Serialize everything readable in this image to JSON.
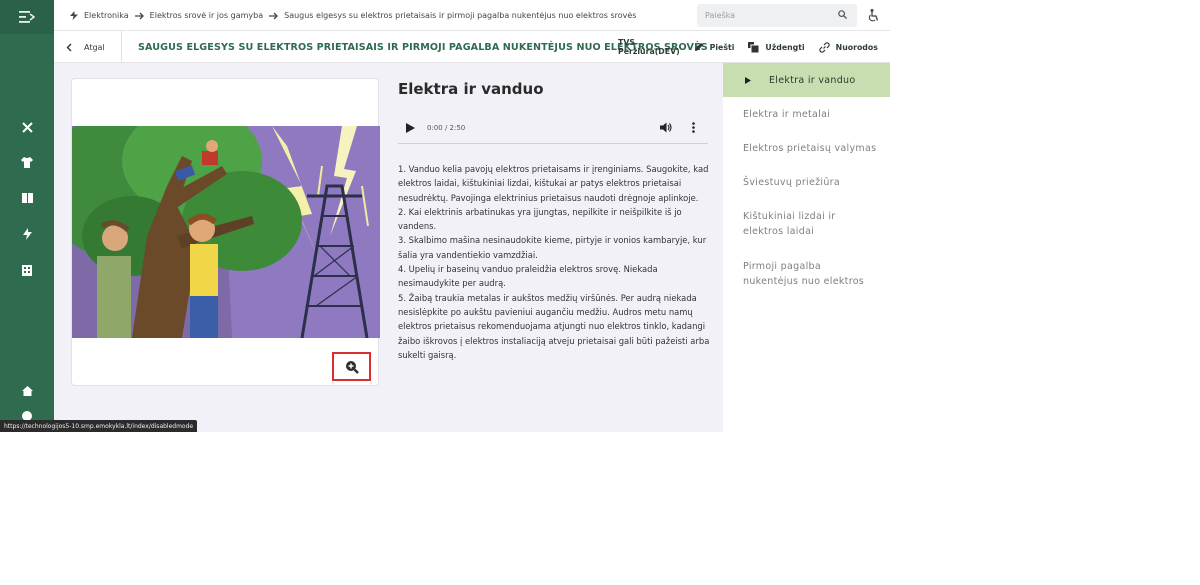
{
  "breadcrumbs": {
    "item1": "Elektronika",
    "item2": "Elektros srovė ir jos gamyba",
    "item3": "Saugus elgesys su elektros prietaisais ir pirmoji pagalba nukentėjus nuo elektros srovės"
  },
  "search": {
    "placeholder": "Paieška"
  },
  "header": {
    "back_label": "Atgal",
    "title": "SAUGUS ELGESYS SU ELEKTROS PRIETAISAIS IR PIRMOJI PAGALBA NUKENTĖJUS NUO ELEKTROS SROVĖS",
    "tvs": "TVS Peržiūra(DEV)",
    "draw": "Piešti",
    "cover": "Uždengti",
    "links": "Nuorodos"
  },
  "lesson": {
    "title": "Elektra ir vanduo",
    "audio_time": "0:00 / 2:50",
    "paragraphs": [
      "1. Vanduo kelia pavojų elektros prietaisams ir įrenginiams. Saugokite, kad elektros laidai, kištukiniai lizdai, kištukai ar patys elektros prietaisai nesudrėktų. Pavojinga elektrinius prietaisus naudoti drėgnoje aplinkoje.",
      "2. Kai elektrinis arbatinukas yra įjungtas, nepilkite ir neišpilkite iš jo vandens.",
      "3. Skalbimo mašina nesinaudokite kieme, pirtyje ir vonios kambaryje, kur šalia yra vandentiekio vamzdžiai.",
      "4. Upelių ir baseinų vanduo praleidžia elektros srovę. Niekada nesimaudykite per audrą.",
      "5. Žaibą traukia metalas ir aukštos medžių viršūnės. Per audrą niekada nesislėpkite po aukštu pavieniui augančiu medžiu. Audros metu namų elektros prietaisus rekomenduojama atjungti nuo elektros tinklo, kadangi žaibo iškrovos į elektros instaliaciją atveju prietaisai gali būti pažeisti arba sukelti gaisrą."
    ]
  },
  "sidebar_right": {
    "items": [
      "Elektra ir vanduo",
      "Elektra ir metalai",
      "Elektros prietaisų valymas",
      "Šviestuvų priežiūra",
      "Kištukiniai lizdai ir elektros laidai",
      "Pirmoji pagalba nukentėjus nuo elektros"
    ]
  },
  "status_url": "https://technologijos5-10.smp.emokykla.lt/index/disabledmode",
  "colors": {
    "brand": "#2e6b4f",
    "active_item": "#c8deb0",
    "highlight": "#d9302f"
  },
  "icons": {
    "rail": [
      "menu-collapse-icon",
      "tools-icon",
      "shirt-icon",
      "book-icon",
      "lightning-icon",
      "building-icon",
      "home-icon",
      "help-icon"
    ]
  }
}
